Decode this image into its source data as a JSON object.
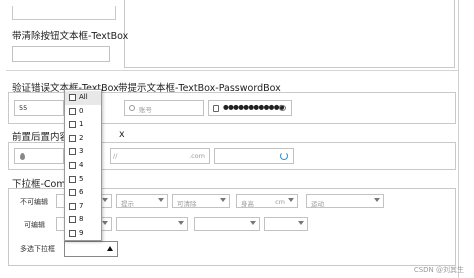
{
  "sections": {
    "clear_button_textbox": "带清除按钮文本框-TextBox",
    "validation_textbox": "验证错误文本框-TextBox",
    "hint_textbox": "带提示文本框-TextBox-PasswordBox",
    "prefix_suffix": "前置后置内容",
    "prefix_suffix_tail": "x",
    "combobox": "下拉框-Comb"
  },
  "fields": {
    "validation_value": "55",
    "account_placeholder": "账号",
    "password_mask": "●●●●●●●●●●●●",
    "domain_suffix": ".com"
  },
  "combobox_rows": {
    "not_editable_label": "不可编辑",
    "editable_label": "可编辑",
    "multi_select_label": "多选下拉框"
  },
  "combo_placeholders": {
    "hint": "提示",
    "clearable": "可清除",
    "unit_value": "身高",
    "unit_suffix": "cm",
    "disabled": "可清除",
    "activity": "运动"
  },
  "dropdown": {
    "items": [
      "All",
      "0",
      "1",
      "2",
      "3",
      "4",
      "5",
      "6",
      "7",
      "8",
      "9"
    ]
  },
  "watermark": "CSDN @刘其生"
}
